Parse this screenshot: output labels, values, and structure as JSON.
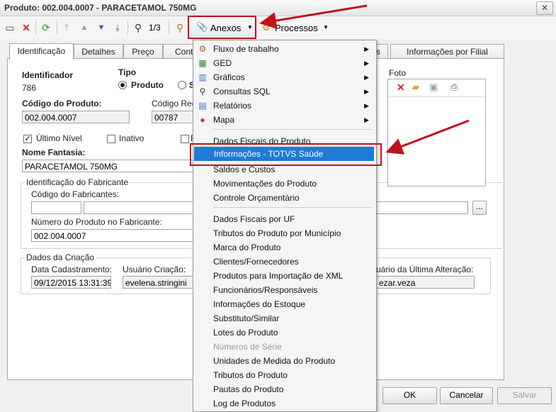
{
  "window": {
    "title": "Produto: 002.004.0007 - PARACETAMOL 750MG",
    "close_label": "✕"
  },
  "toolbar": {
    "counter": "1/3",
    "anexos_label": "Anexos",
    "processos_label": "Processos"
  },
  "tabs": [
    {
      "label": "Identificação"
    },
    {
      "label": "Detalhes"
    },
    {
      "label": "Preço"
    },
    {
      "label": "Contr"
    },
    {
      "label": "s"
    },
    {
      "label": "Informações por Filial"
    }
  ],
  "form": {
    "identificador_label": "Identificador",
    "identificador_value": "786",
    "tipo_label": "Tipo",
    "tipo_option_produto": "Produto",
    "tipo_option_s": "S",
    "codigo_produto_label": "Código do Produto:",
    "codigo_produto_value": "002.004.0007",
    "codigo_red_label": "Código Red",
    "codigo_red_value": "00787",
    "ultimo_nivel_label": "Último Nível",
    "inativo_label": "Inativo",
    "third_check_label": "F",
    "nome_fantasia_label": "Nome Fantasia:",
    "nome_fantasia_value": "PARACETAMOL 750MG",
    "fabricante_group_label": "Identificação do Fabricante",
    "codigo_fabricantes_label": "Código do Fabricantes:",
    "numero_produto_fabricante_label": "Número do Produto no Fabricante:",
    "numero_produto_fabricante_value": "002.004.0007",
    "ellipsis_label": "...",
    "criacao_group_label": "Dados da Criação",
    "data_cadastramento_label": "Data Cadastramento:",
    "data_cadastramento_value": "09/12/2015 13:31:39",
    "usuario_criacao_label": "Usuário Criação:",
    "usuario_criacao_value": "evelena.stringini",
    "usuario_ultima_alteracao_label": "uário da Última Alteração:",
    "usuario_ultima_alteracao_value": "ezar.veza",
    "foto_label": "Foto"
  },
  "buttons": {
    "ok": "OK",
    "cancelar": "Cancelar",
    "salvar": "Salvar"
  },
  "menu": {
    "submenus": [
      {
        "label": "Fluxo de trabalho",
        "icon": "workflow-icon"
      },
      {
        "label": "GED",
        "icon": "ged-icon"
      },
      {
        "label": "Gráficos",
        "icon": "chart-icon"
      },
      {
        "label": "Consultas SQL",
        "icon": "sql-query-icon"
      },
      {
        "label": "Relatórios",
        "icon": "report-icon"
      },
      {
        "label": "Mapa",
        "icon": "map-pin-icon"
      }
    ],
    "group2": [
      {
        "label": "Dados Fiscais do Produto"
      },
      {
        "label": "Informações - TOTVS Saúde"
      },
      {
        "label": "Saldos e Custos"
      },
      {
        "label": "Movimentações do Produto"
      },
      {
        "label": "Controle Orçamentário"
      }
    ],
    "group3": [
      {
        "label": "Dados Fiscais por UF"
      },
      {
        "label": "Tributos do Produto por Município"
      },
      {
        "label": "Marca do Produto"
      },
      {
        "label": "Clientes/Fornecedores"
      },
      {
        "label": "Produtos para Importação de XML"
      },
      {
        "label": "Funcionários/Responsáveis"
      },
      {
        "label": "Informações do Estoque"
      },
      {
        "label": "Substituto/Similar"
      },
      {
        "label": "Lotes do Produto"
      },
      {
        "label": "Números de Série"
      },
      {
        "label": "Unidades de Medida do Produto"
      },
      {
        "label": "Tributos do Produto"
      },
      {
        "label": "Pautas do Produto"
      },
      {
        "label": "Log de Produtos"
      }
    ]
  },
  "colors": {
    "highlight_red": "#c0121b",
    "selection_blue": "#1e7bd6"
  }
}
